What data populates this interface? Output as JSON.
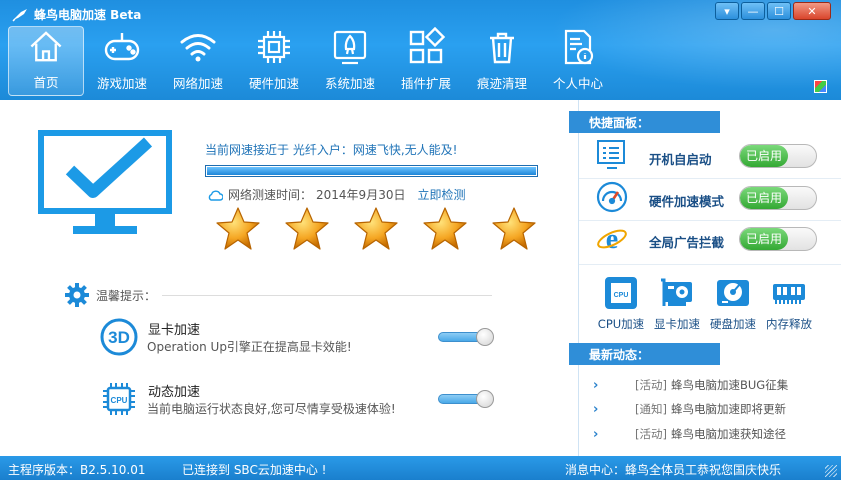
{
  "window": {
    "title": "蜂鸟电脑加速 Beta",
    "controls": {
      "menu": "▾",
      "minimize": "—",
      "maximize": "☐",
      "close": "✕"
    }
  },
  "nav": [
    {
      "label": "首页",
      "icon": "home-icon"
    },
    {
      "label": "游戏加速",
      "icon": "gamepad-icon"
    },
    {
      "label": "网络加速",
      "icon": "wifi-icon"
    },
    {
      "label": "硬件加速",
      "icon": "chip-icon"
    },
    {
      "label": "系统加速",
      "icon": "rocket-icon"
    },
    {
      "label": "插件扩展",
      "icon": "plugin-icon"
    },
    {
      "label": "痕迹清理",
      "icon": "trash-icon"
    },
    {
      "label": "个人中心",
      "icon": "profile-icon"
    }
  ],
  "speed": {
    "status_text": "当前网速接近于 光纤入户：网速飞快,无人能及!",
    "progress": 1.0,
    "test_label": "网络测速时间：",
    "test_date": "2014年9月30日",
    "test_link": "立即检测",
    "stars": 5
  },
  "tips": {
    "heading": "温馨提示：",
    "items": [
      {
        "icon": "3d-icon",
        "title": "显卡加速",
        "desc": "Operation Up引擎正在提高显卡效能!"
      },
      {
        "icon": "cpu-icon",
        "title": "动态加速",
        "desc": "当前电脑运行状态良好,您可尽情享受极速体验!"
      }
    ]
  },
  "quick_panel": {
    "heading": "快捷面板：",
    "items": [
      {
        "label": "开机自启动",
        "state": "已启用",
        "icon": "startup-icon"
      },
      {
        "label": "硬件加速模式",
        "state": "已启用",
        "icon": "gauge-icon"
      },
      {
        "label": "全局广告拦截",
        "state": "已启用",
        "icon": "ie-icon"
      }
    ]
  },
  "tools": [
    {
      "label": "CPU加速",
      "icon": "cpu-chip-icon",
      "badge": "CPU"
    },
    {
      "label": "显卡加速",
      "icon": "graphics-card-icon"
    },
    {
      "label": "硬盘加速",
      "icon": "hard-disk-icon"
    },
    {
      "label": "内存释放",
      "icon": "memory-icon"
    }
  ],
  "news": {
    "heading": "最新动态：",
    "items": [
      {
        "tag": "[活动]",
        "text": "蜂鸟电脑加速BUG征集"
      },
      {
        "tag": "[通知]",
        "text": "蜂鸟电脑加速即将更新"
      },
      {
        "tag": "[活动]",
        "text": "蜂鸟电脑加速获知途径"
      }
    ]
  },
  "status": {
    "version": "主程序版本：B2.5.10.01",
    "connection": "已连接到 SBC云加速中心 !",
    "message": "消息中心：蜂鸟全体员工恭祝您国庆快乐"
  },
  "colors": {
    "accent": "#2a9ae8",
    "toggle_on": "#3cb043",
    "link": "#1f73b7",
    "star": "#f5a623"
  }
}
